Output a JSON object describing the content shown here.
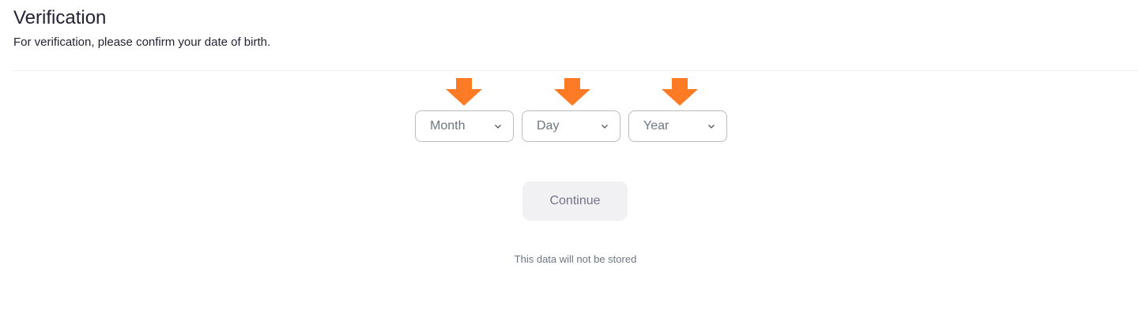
{
  "header": {
    "title": "Verification",
    "subtitle": "For verification, please confirm your date of birth."
  },
  "dob": {
    "month_label": "Month",
    "day_label": "Day",
    "year_label": "Year"
  },
  "actions": {
    "continue_label": "Continue"
  },
  "footer": {
    "note": "This data will not be stored"
  },
  "colors": {
    "annotation_arrow": "#fd7b24",
    "button_bg": "#f1f1f4",
    "divider": "#ededf4"
  },
  "icons": {
    "select_chevron": "chevron-down-icon",
    "annotation": "arrow-down-icon"
  }
}
